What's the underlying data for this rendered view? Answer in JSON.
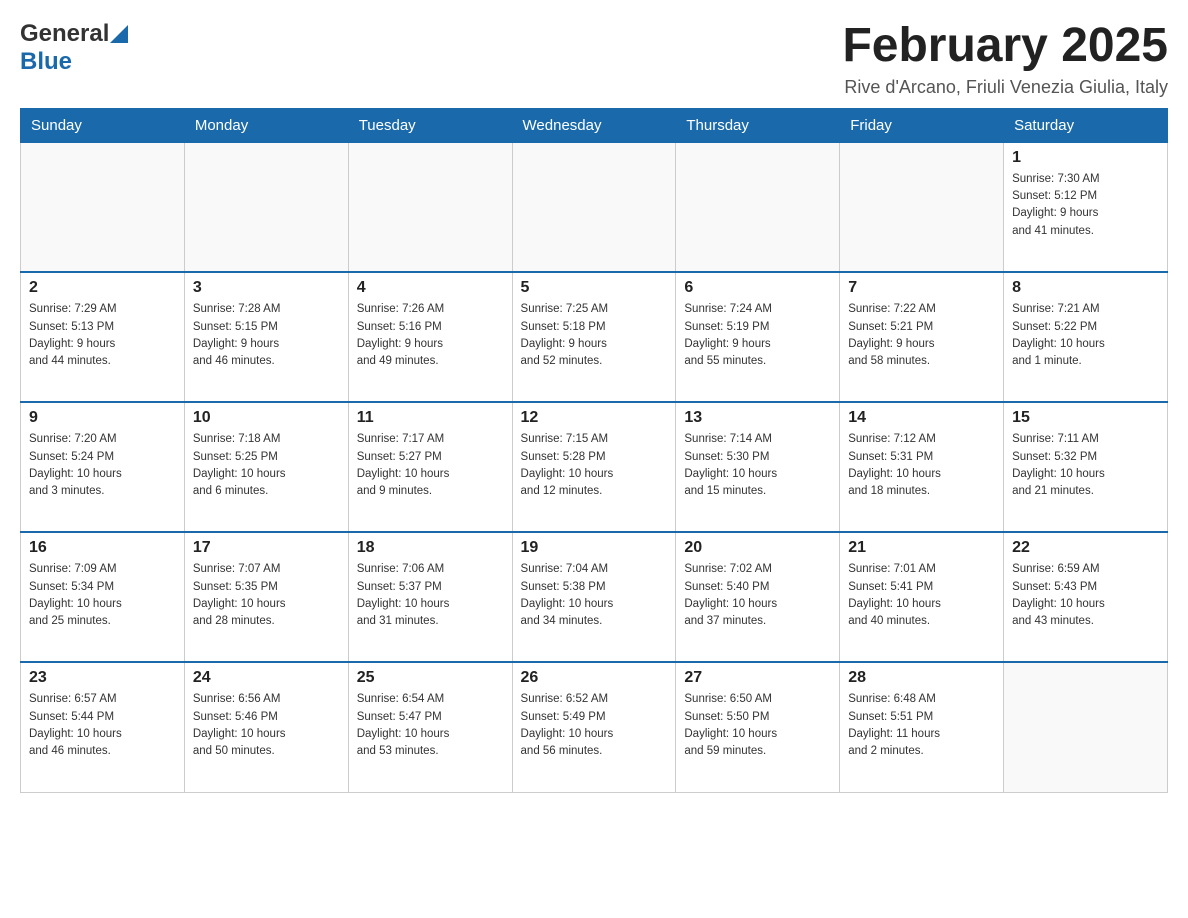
{
  "header": {
    "logo_general": "General",
    "logo_blue": "Blue",
    "title": "February 2025",
    "subtitle": "Rive d'Arcano, Friuli Venezia Giulia, Italy"
  },
  "weekdays": [
    "Sunday",
    "Monday",
    "Tuesday",
    "Wednesday",
    "Thursday",
    "Friday",
    "Saturday"
  ],
  "weeks": [
    [
      {
        "day": "",
        "info": ""
      },
      {
        "day": "",
        "info": ""
      },
      {
        "day": "",
        "info": ""
      },
      {
        "day": "",
        "info": ""
      },
      {
        "day": "",
        "info": ""
      },
      {
        "day": "",
        "info": ""
      },
      {
        "day": "1",
        "info": "Sunrise: 7:30 AM\nSunset: 5:12 PM\nDaylight: 9 hours\nand 41 minutes."
      }
    ],
    [
      {
        "day": "2",
        "info": "Sunrise: 7:29 AM\nSunset: 5:13 PM\nDaylight: 9 hours\nand 44 minutes."
      },
      {
        "day": "3",
        "info": "Sunrise: 7:28 AM\nSunset: 5:15 PM\nDaylight: 9 hours\nand 46 minutes."
      },
      {
        "day": "4",
        "info": "Sunrise: 7:26 AM\nSunset: 5:16 PM\nDaylight: 9 hours\nand 49 minutes."
      },
      {
        "day": "5",
        "info": "Sunrise: 7:25 AM\nSunset: 5:18 PM\nDaylight: 9 hours\nand 52 minutes."
      },
      {
        "day": "6",
        "info": "Sunrise: 7:24 AM\nSunset: 5:19 PM\nDaylight: 9 hours\nand 55 minutes."
      },
      {
        "day": "7",
        "info": "Sunrise: 7:22 AM\nSunset: 5:21 PM\nDaylight: 9 hours\nand 58 minutes."
      },
      {
        "day": "8",
        "info": "Sunrise: 7:21 AM\nSunset: 5:22 PM\nDaylight: 10 hours\nand 1 minute."
      }
    ],
    [
      {
        "day": "9",
        "info": "Sunrise: 7:20 AM\nSunset: 5:24 PM\nDaylight: 10 hours\nand 3 minutes."
      },
      {
        "day": "10",
        "info": "Sunrise: 7:18 AM\nSunset: 5:25 PM\nDaylight: 10 hours\nand 6 minutes."
      },
      {
        "day": "11",
        "info": "Sunrise: 7:17 AM\nSunset: 5:27 PM\nDaylight: 10 hours\nand 9 minutes."
      },
      {
        "day": "12",
        "info": "Sunrise: 7:15 AM\nSunset: 5:28 PM\nDaylight: 10 hours\nand 12 minutes."
      },
      {
        "day": "13",
        "info": "Sunrise: 7:14 AM\nSunset: 5:30 PM\nDaylight: 10 hours\nand 15 minutes."
      },
      {
        "day": "14",
        "info": "Sunrise: 7:12 AM\nSunset: 5:31 PM\nDaylight: 10 hours\nand 18 minutes."
      },
      {
        "day": "15",
        "info": "Sunrise: 7:11 AM\nSunset: 5:32 PM\nDaylight: 10 hours\nand 21 minutes."
      }
    ],
    [
      {
        "day": "16",
        "info": "Sunrise: 7:09 AM\nSunset: 5:34 PM\nDaylight: 10 hours\nand 25 minutes."
      },
      {
        "day": "17",
        "info": "Sunrise: 7:07 AM\nSunset: 5:35 PM\nDaylight: 10 hours\nand 28 minutes."
      },
      {
        "day": "18",
        "info": "Sunrise: 7:06 AM\nSunset: 5:37 PM\nDaylight: 10 hours\nand 31 minutes."
      },
      {
        "day": "19",
        "info": "Sunrise: 7:04 AM\nSunset: 5:38 PM\nDaylight: 10 hours\nand 34 minutes."
      },
      {
        "day": "20",
        "info": "Sunrise: 7:02 AM\nSunset: 5:40 PM\nDaylight: 10 hours\nand 37 minutes."
      },
      {
        "day": "21",
        "info": "Sunrise: 7:01 AM\nSunset: 5:41 PM\nDaylight: 10 hours\nand 40 minutes."
      },
      {
        "day": "22",
        "info": "Sunrise: 6:59 AM\nSunset: 5:43 PM\nDaylight: 10 hours\nand 43 minutes."
      }
    ],
    [
      {
        "day": "23",
        "info": "Sunrise: 6:57 AM\nSunset: 5:44 PM\nDaylight: 10 hours\nand 46 minutes."
      },
      {
        "day": "24",
        "info": "Sunrise: 6:56 AM\nSunset: 5:46 PM\nDaylight: 10 hours\nand 50 minutes."
      },
      {
        "day": "25",
        "info": "Sunrise: 6:54 AM\nSunset: 5:47 PM\nDaylight: 10 hours\nand 53 minutes."
      },
      {
        "day": "26",
        "info": "Sunrise: 6:52 AM\nSunset: 5:49 PM\nDaylight: 10 hours\nand 56 minutes."
      },
      {
        "day": "27",
        "info": "Sunrise: 6:50 AM\nSunset: 5:50 PM\nDaylight: 10 hours\nand 59 minutes."
      },
      {
        "day": "28",
        "info": "Sunrise: 6:48 AM\nSunset: 5:51 PM\nDaylight: 11 hours\nand 2 minutes."
      },
      {
        "day": "",
        "info": ""
      }
    ]
  ]
}
